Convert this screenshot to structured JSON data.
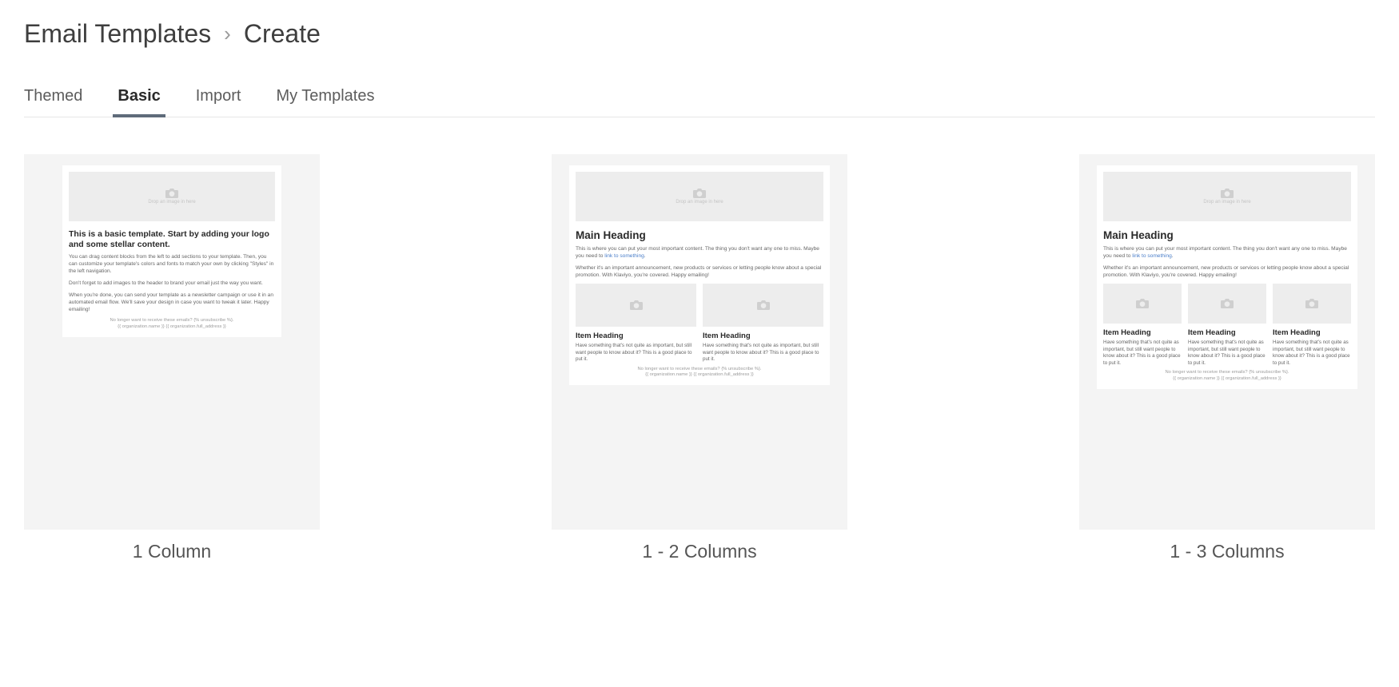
{
  "breadcrumb": {
    "root": "Email Templates",
    "chevron": "›",
    "current": "Create"
  },
  "tabs": {
    "themed": "Themed",
    "basic": "Basic",
    "import": "Import",
    "my_templates": "My Templates"
  },
  "templates": {
    "one_col": {
      "label": "1 Column",
      "hero_placeholder": "Drop an image in here",
      "headline": "This is a basic template. Start by adding your logo and some stellar content.",
      "p1": "You can drag content blocks from the left to add sections to your template. Then, you can customize your template's colors and fonts to match your own by clicking \"Styles\" in the left navigation.",
      "p2": "Don't forget to add images to the header to brand your email just the way you want.",
      "p3": "When you're done, you can send your template as a newsletter campaign or use it in an automated email flow. We'll save your design in case you want to tweak it later. Happy emailing!",
      "footer1": "No longer want to receive these emails? {% unsubscribe %}.",
      "footer2": "{{ organization.name }} {{ organization.full_address }}"
    },
    "two_col": {
      "label": "1 - 2 Columns",
      "hero_placeholder": "Drop an image in here",
      "heading": "Main Heading",
      "intro_pre": "This is where you can put your most important content. The thing you don't want any one to miss. Maybe you need to ",
      "intro_link": "link to something",
      "intro_post": ".",
      "body": "Whether it's an important announcement, new products or services or letting people know about a special promotion. With Klaviyo, you're covered. Happy emailing!",
      "item_heading": "Item Heading",
      "item_body": "Have something that's not quite as important, but still want people to know about it? This is a good place to put it.",
      "footer1": "No longer want to receive these emails? {% unsubscribe %}.",
      "footer2": "{{ organization.name }} {{ organization.full_address }}"
    },
    "three_col": {
      "label": "1 - 3 Columns",
      "hero_placeholder": "Drop an image in here",
      "heading": "Main Heading",
      "intro_pre": "This is where you can put your most important content. The thing you don't want any one to miss. Maybe you need to ",
      "intro_link": "link to something",
      "intro_post": ".",
      "body": "Whether it's an important announcement, new products or services or letting people know about a special promotion. With Klaviyo, you're covered. Happy emailing!",
      "item_heading": "Item Heading",
      "item_body": "Have something that's not quite as important, but still want people to know about it? This is a good place to put it.",
      "footer1": "No longer want to receive these emails? {% unsubscribe %}.",
      "footer2": "{{ organization.name }} {{ organization.full_address }}"
    }
  }
}
